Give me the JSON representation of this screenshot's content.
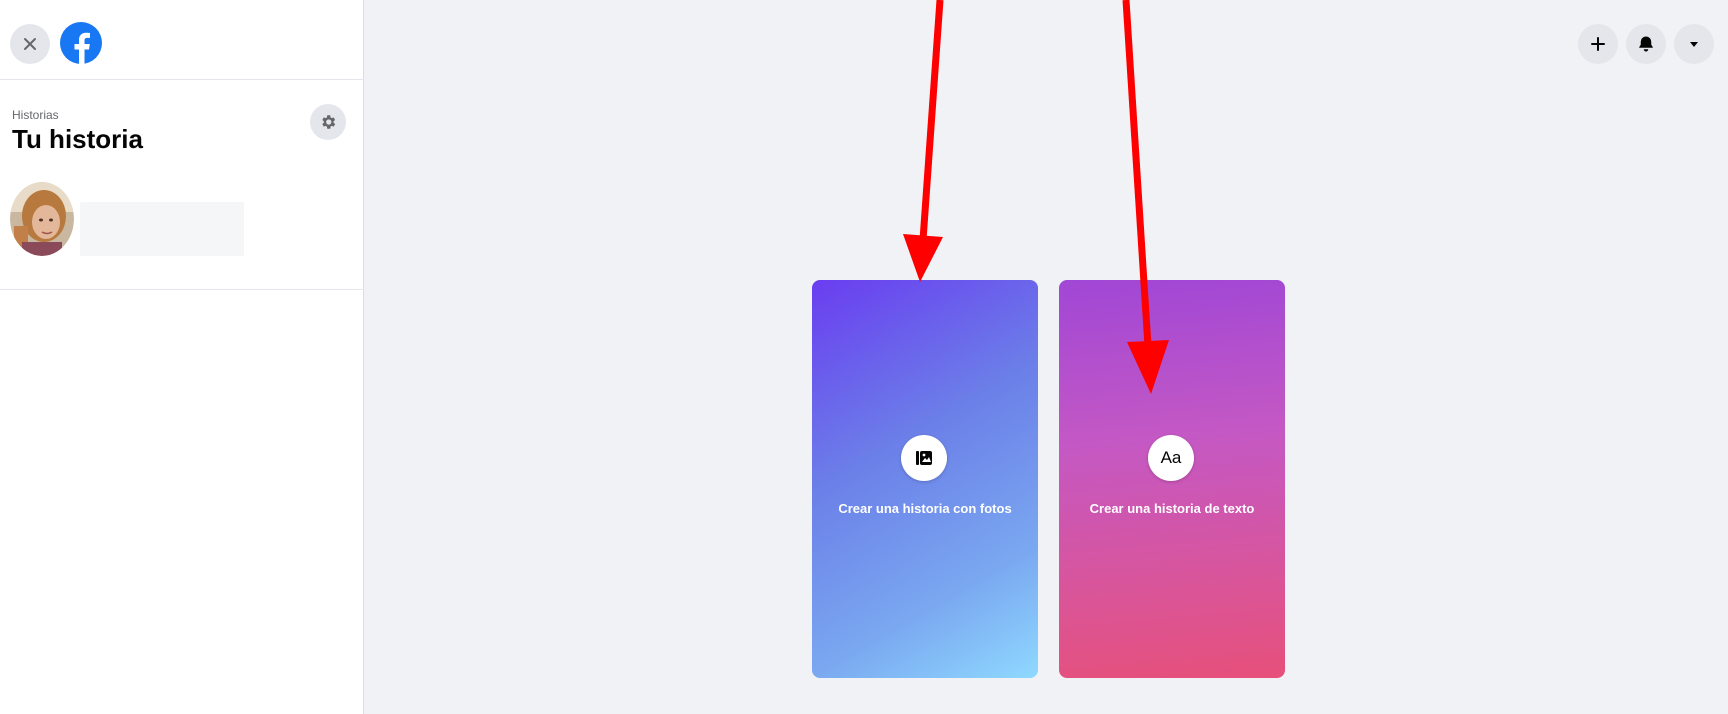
{
  "sidebar": {
    "close_icon": "close-icon",
    "logo_icon": "facebook-logo-icon",
    "section_caption": "Historias",
    "section_title": "Tu historia",
    "settings_icon": "gear-icon",
    "user_avatar": "avatar"
  },
  "topbar": {
    "create_icon": "plus-icon",
    "notifications_icon": "bell-icon",
    "account_menu_icon": "caret-down-icon"
  },
  "cards": [
    {
      "label": "Crear una historia con fotos",
      "icon": "photo-icon",
      "colors": [
        "#6a3df0",
        "#8fd9ff"
      ]
    },
    {
      "label": "Crear una historia de texto",
      "icon_text": "Aa",
      "colors": [
        "#a047d6",
        "#e6507a"
      ]
    }
  ],
  "colors": {
    "background": "#f0f2f5",
    "facebook_blue": "#1877f2",
    "annotation_arrow": "#ff0000"
  }
}
